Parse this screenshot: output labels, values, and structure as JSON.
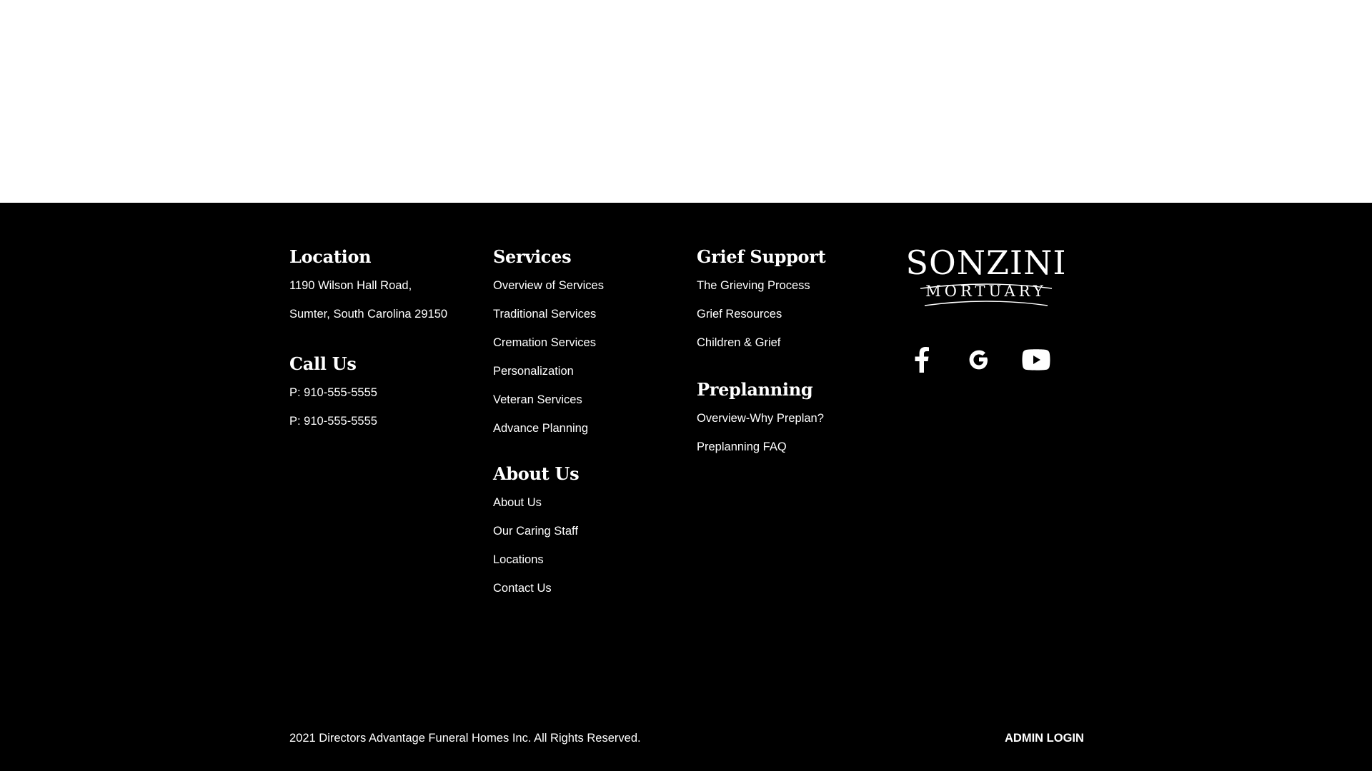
{
  "footer": {
    "location": {
      "heading": "Location",
      "address_line1": "1190 Wilson Hall Road,",
      "address_line2": "Sumter, South Carolina 29150"
    },
    "call_us": {
      "heading": "Call Us",
      "phones": [
        "P: 910-555-5555",
        "P: 910-555-5555"
      ]
    },
    "services": {
      "heading": "Services",
      "links": [
        "Overview of Services",
        "Traditional Services",
        "Cremation Services",
        "Personalization",
        "Veteran Services",
        "Advance Planning"
      ]
    },
    "about_us": {
      "heading": "About Us",
      "links": [
        "About Us",
        "Our Caring Staff",
        "Locations",
        "Contact Us"
      ]
    },
    "grief_support": {
      "heading": "Grief Support",
      "links": [
        "The Grieving Process",
        "Grief Resources",
        "Children & Grief"
      ]
    },
    "preplanning": {
      "heading": "Preplanning",
      "links": [
        "Overview-Why Preplan?",
        "Preplanning FAQ"
      ]
    },
    "logo": {
      "name": "SONZINI",
      "subtitle": "MORTUARY"
    },
    "social": {
      "icons": [
        "facebook-icon",
        "google-icon",
        "youtube-icon"
      ]
    },
    "copyright": "2021 Directors Advantage Funeral Homes Inc. All Rights Reserved.",
    "admin_login": "ADMIN LOGIN"
  },
  "colors": {
    "footer_background": "#000000",
    "footer_text": "#ffffff",
    "page_background": "#ffffff"
  }
}
